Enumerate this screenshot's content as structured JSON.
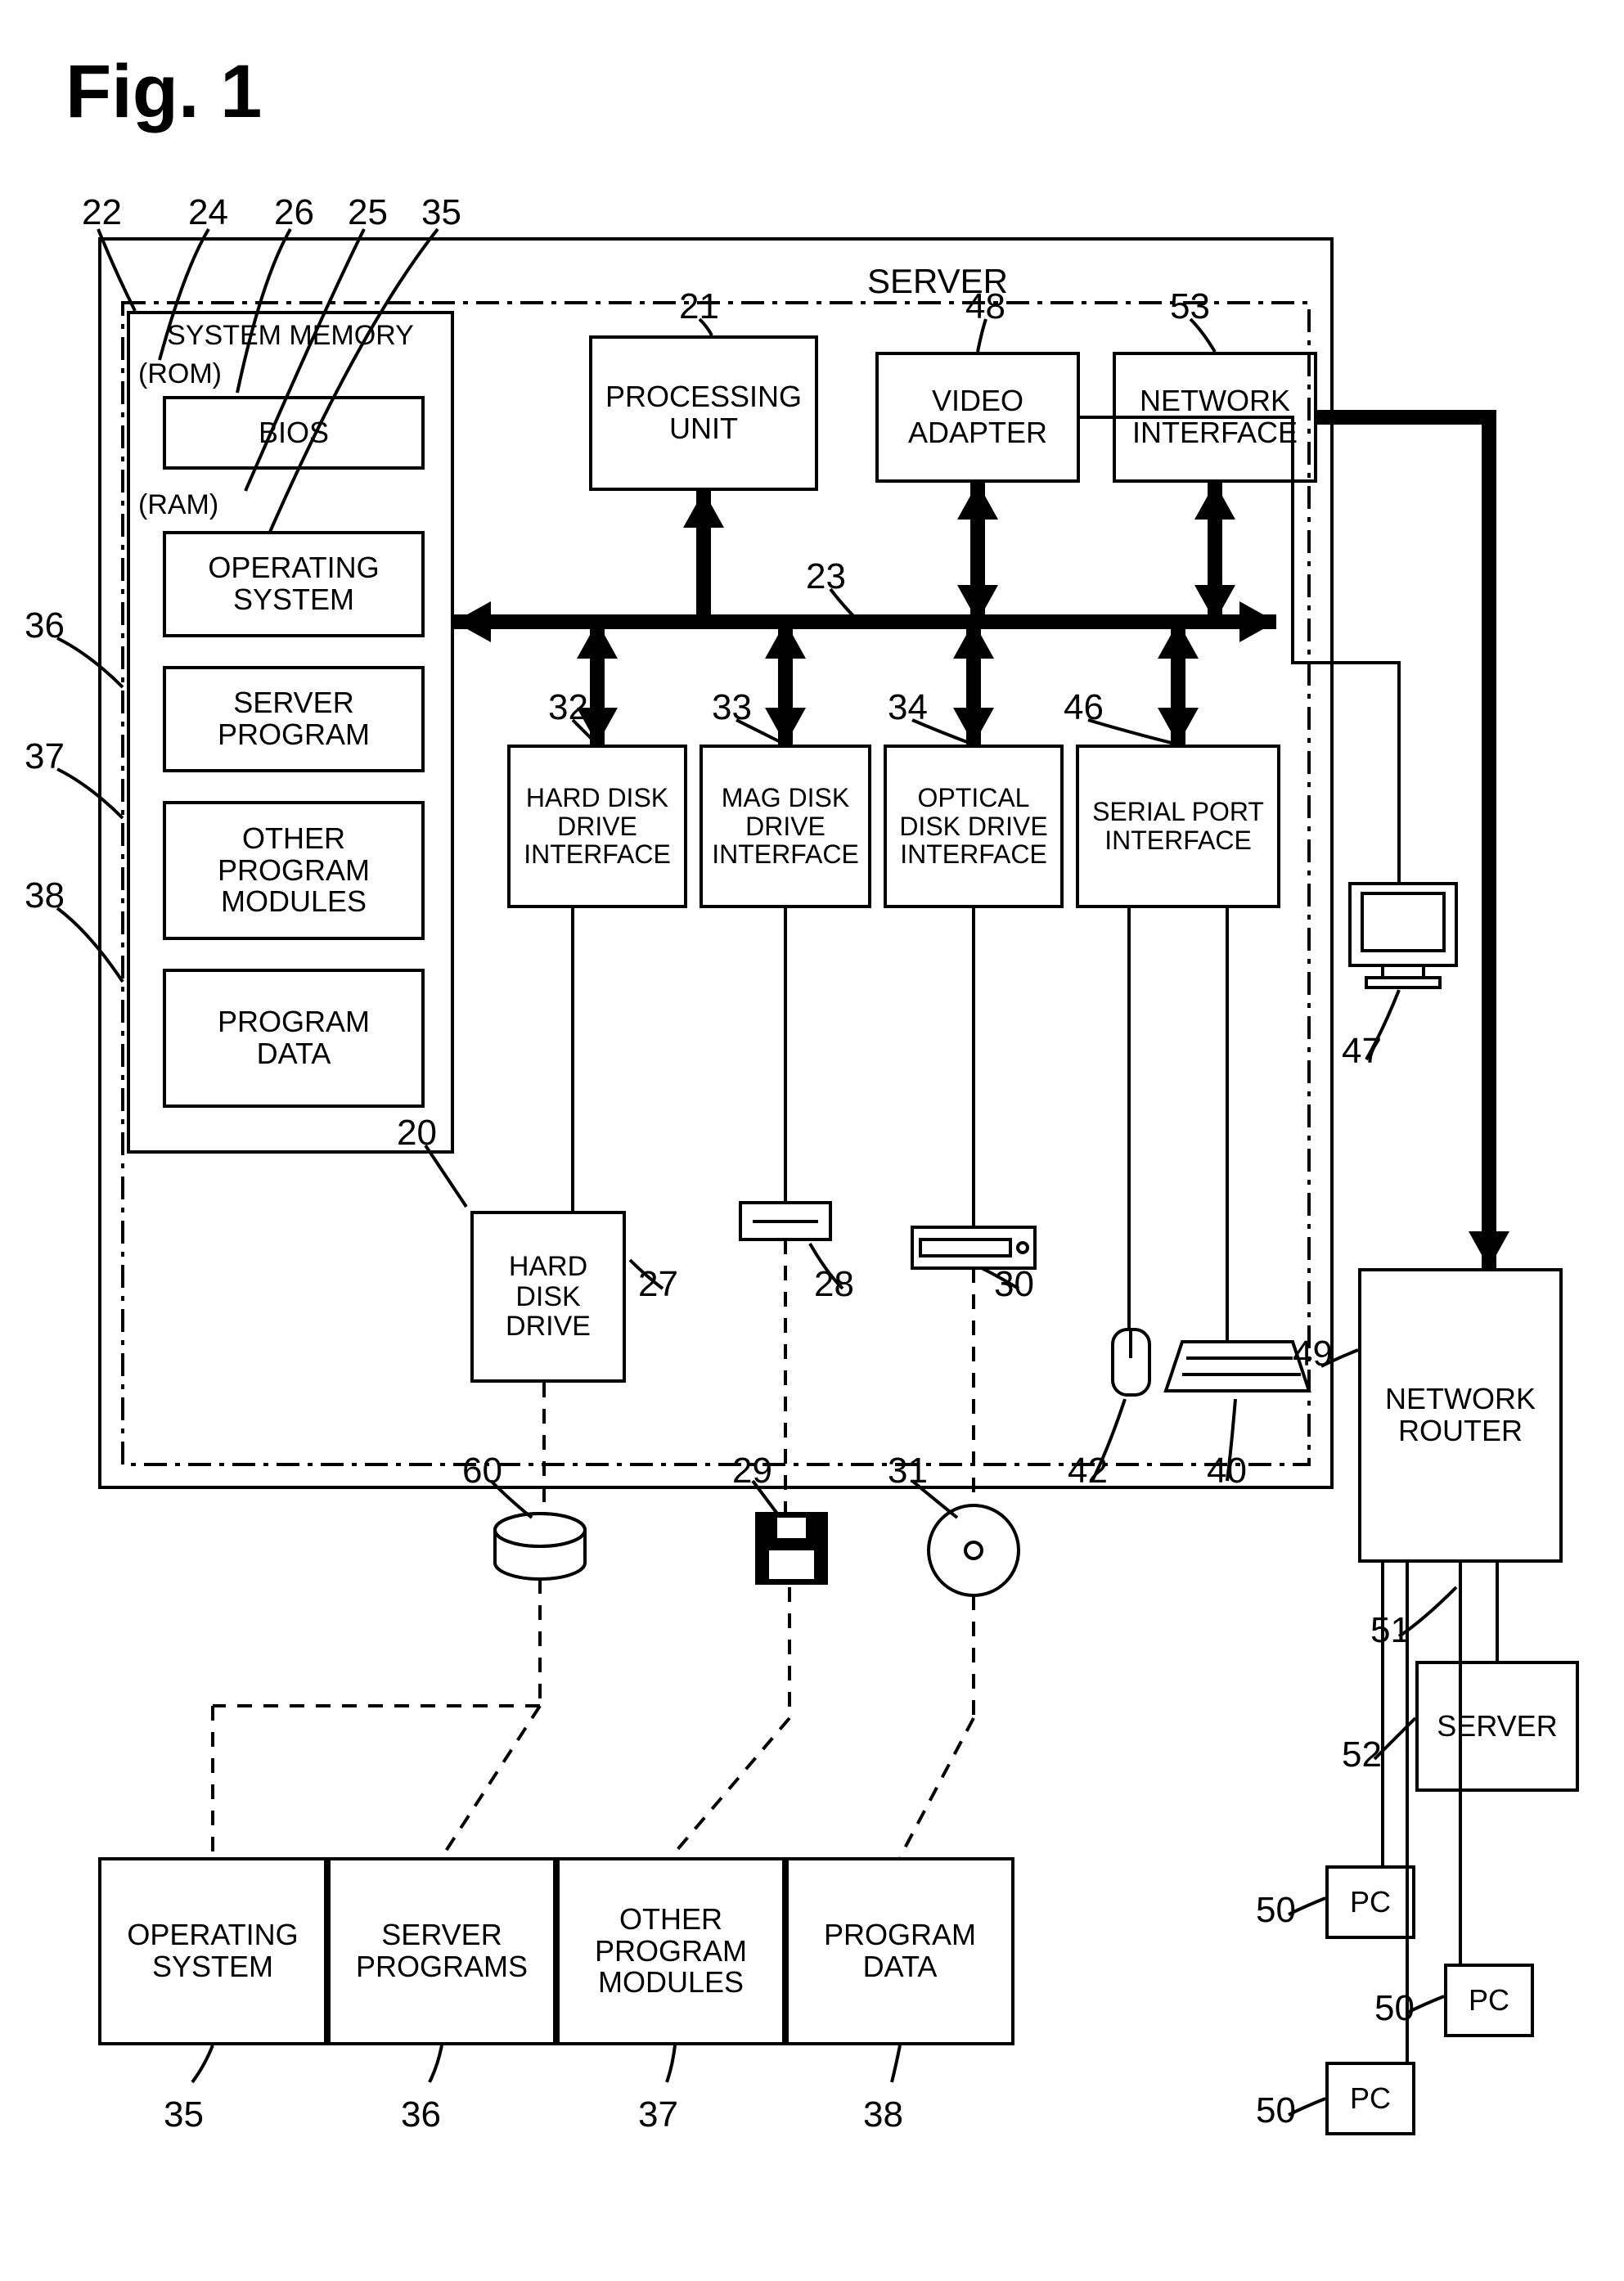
{
  "figure_label": "Fig. 1",
  "server_label": "SERVER",
  "sysmem": {
    "system_memory": "SYSTEM MEMORY",
    "rom": "(ROM)",
    "bios": "BIOS",
    "ram": "(RAM)",
    "os": "OPERATING\nSYSTEM",
    "server_prog": "SERVER\nPROGRAM",
    "other_prog": "OTHER\nPROGRAM\nMODULES",
    "program_data": "PROGRAM\nDATA"
  },
  "blocks": {
    "processing_unit": "PROCESSING\nUNIT",
    "video_adapter": "VIDEO\nADAPTER",
    "network_interface": "NETWORK\nINTERFACE",
    "hdd_if": "HARD DISK\nDRIVE\nINTERFACE",
    "mag_if": "MAG DISK\nDRIVE\nINTERFACE",
    "opt_if": "OPTICAL\nDISK DRIVE\nINTERFACE",
    "serial_if": "SERIAL PORT\nINTERFACE",
    "hdd": "HARD\nDISK\nDRIVE",
    "network_router": "NETWORK\nROUTER",
    "server2": "SERVER",
    "pc": "PC"
  },
  "bottom_row": {
    "os": "OPERATING\nSYSTEM",
    "server_programs": "SERVER\nPROGRAMS",
    "other_program_modules": "OTHER\nPROGRAM\nMODULES",
    "program_data": "PROGRAM\nDATA"
  },
  "callouts": {
    "c20": "20",
    "c21": "21",
    "c22": "22",
    "c23": "23",
    "c24": "24",
    "c25": "25",
    "c26": "26",
    "c27": "27",
    "c28": "28",
    "c29": "29",
    "c30": "30",
    "c31": "31",
    "c32": "32",
    "c33": "33",
    "c34": "34",
    "c35b": "35",
    "c35": "35",
    "c36b": "36",
    "c36": "36",
    "c37b": "37",
    "c37": "37",
    "c38b": "38",
    "c38": "38",
    "c40": "40",
    "c42": "42",
    "c46": "46",
    "c47": "47",
    "c48": "48",
    "c49": "49",
    "c50a": "50",
    "c50b": "50",
    "c50c": "50",
    "c51": "51",
    "c52": "52",
    "c53": "53",
    "c60": "60"
  }
}
